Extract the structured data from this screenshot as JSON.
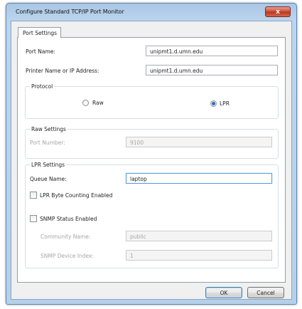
{
  "window": {
    "title": "Configure Standard TCP/IP Port Monitor",
    "close_glyph": "x",
    "close_icon": "close-icon"
  },
  "tabs": [
    {
      "label": "Port Settings",
      "selected": true
    }
  ],
  "port_settings": {
    "port_name_label": "Port Name:",
    "port_name_value": "unipmt1.d.umn.edu",
    "printer_name_label": "Printer Name or IP Address:",
    "printer_name_value": "unipmt1.d.umn.edu"
  },
  "protocol": {
    "group_label": "Protocol",
    "options": [
      {
        "label": "Raw",
        "checked": false
      },
      {
        "label": "LPR",
        "checked": true
      }
    ]
  },
  "raw_settings": {
    "group_label": "Raw Settings",
    "port_number_label": "Port Number:",
    "port_number_value": "9100",
    "enabled": false
  },
  "lpr_settings": {
    "group_label": "LPR Settings",
    "queue_name_label": "Queue Name:",
    "queue_name_value": "laptop",
    "byte_counting_label": "LPR Byte Counting Enabled",
    "byte_counting_checked": false
  },
  "snmp": {
    "enable_label": "SNMP Status Enabled",
    "enabled_checked": false,
    "community_name_label": "Community Name:",
    "community_name_value": "public",
    "device_index_label": "SNMP Device Index:",
    "device_index_value": "1"
  },
  "buttons": {
    "ok": "OK",
    "cancel": "Cancel"
  },
  "colors": {
    "title_bar": "#b7d0ea",
    "close_button": "#cb4c34",
    "focus_border": "#5a9ed6"
  }
}
